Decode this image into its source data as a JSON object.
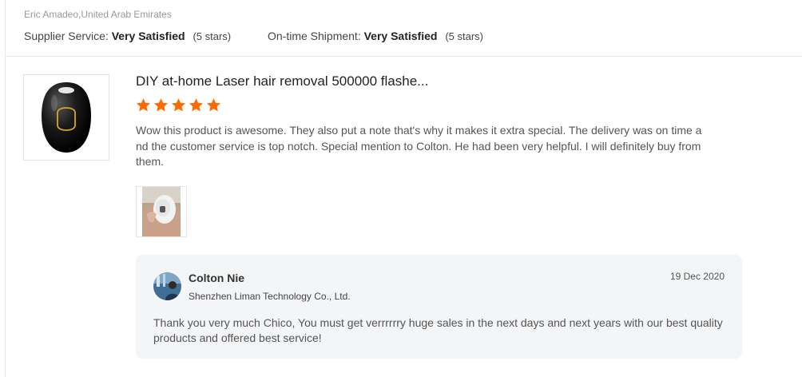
{
  "reviewer": {
    "name_location": "Eric Amadeo,United Arab Emirates"
  },
  "ratings": [
    {
      "label": "Supplier Service:",
      "value": "Very Satisfied",
      "stars": "(5 stars)"
    },
    {
      "label": "On-time Shipment:",
      "value": "Very Satisfied",
      "stars": "(5 stars)"
    }
  ],
  "review": {
    "product_title": "DIY at-home Laser hair removal 500000 flashe...",
    "star_count": 5,
    "star_color": "#ff6a00",
    "text": "Wow this product is awesome. They also put a note that's why it makes it extra special. The delivery was on time and the customer service is top notch. Special mention to Colton. He had been very helpful. I will definitely buy from them."
  },
  "reply": {
    "name": "Colton Nie",
    "company": "Shenzhen Liman Technology Co., Ltd.",
    "date": "19 Dec 2020",
    "text": "Thank you very much Chico, You must get verrrrrry huge sales in the next days and next years with our best quality products and offered best service!"
  }
}
